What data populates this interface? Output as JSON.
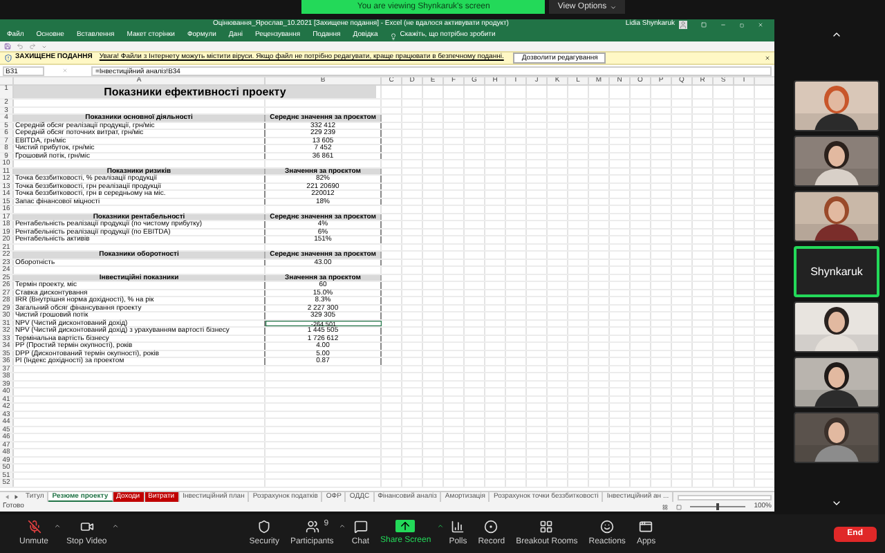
{
  "banner": {
    "text": "You are viewing Shynkaruk's screen",
    "options": "View Options"
  },
  "excel": {
    "title": "Оцінювання_Ярослав_10.2021 [Захищене подання] - Excel (не вдалося активувати продукт)",
    "user": "Lidia Shynkaruk",
    "menu": [
      "Файл",
      "Основне",
      "Вставлення",
      "Макет сторінки",
      "Формули",
      "Дані",
      "Рецензування",
      "Подання",
      "Довідка"
    ],
    "search": "Скажіть, що потрібно зробити",
    "security_bar": {
      "label": "ЗАХИЩЕНЕ ПОДАННЯ",
      "message": "Увага! Файли з Інтернету можуть містити віруси. Якщо файл не потрібно редагувати, краще працювати в безпечному поданні.",
      "button": "Дозволити редагування"
    },
    "formula_bar": {
      "name_box": "B31",
      "formula": "=Інвестиційний аналіз!B34"
    },
    "columns": [
      "A",
      "B",
      "C",
      "D",
      "E",
      "F",
      "G",
      "H",
      "I",
      "J",
      "K",
      "L",
      "M",
      "N",
      "O",
      "P",
      "Q",
      "R",
      "S",
      "T"
    ],
    "rows": [
      {
        "number": "1",
        "kind": "title",
        "label": "Показники ефективності проекту"
      },
      {
        "number": "2",
        "kind": "empty"
      },
      {
        "number": "3",
        "kind": "empty"
      },
      {
        "number": "4",
        "kind": "header",
        "label": "Показники основної діяльності",
        "value": "Середнє значення за проєктом"
      },
      {
        "number": "5",
        "kind": "data",
        "label": "Середній обсяг реалізації продукції, грн/міс",
        "value": "332 412",
        "selected": false
      },
      {
        "number": "6",
        "kind": "data",
        "label": "Середній обсяг поточних витрат, грн/міс",
        "value": "229 239",
        "selected": false
      },
      {
        "number": "7",
        "kind": "data",
        "label": "EBITDA, грн/міс",
        "value": "13 605",
        "selected": false
      },
      {
        "number": "8",
        "kind": "data",
        "label": "Чистий прибуток, грн/міс",
        "value": "7 452",
        "selected": false
      },
      {
        "number": "9",
        "kind": "data",
        "label": "Грошовий потік, грн/міс",
        "value": "36 861",
        "selected": false
      },
      {
        "number": "10",
        "kind": "empty"
      },
      {
        "number": "11",
        "kind": "header",
        "label": "Показники ризиків",
        "value": "Значення за проєктом"
      },
      {
        "number": "12",
        "kind": "data",
        "label": "Точка беззбитковості, % реалізації продукції",
        "value": "82%",
        "selected": false
      },
      {
        "number": "13",
        "kind": "data",
        "label": "Точка беззбитковості, грн реалізації продукції",
        "value": "221 20690",
        "selected": false
      },
      {
        "number": "14",
        "kind": "data",
        "label": "Точка беззбитковості, грн в середньому на міс.",
        "value": "220012",
        "selected": false
      },
      {
        "number": "15",
        "kind": "data",
        "label": "Запас фінансової міцності",
        "value": "18%",
        "selected": false
      },
      {
        "number": "16",
        "kind": "empty"
      },
      {
        "number": "17",
        "kind": "header",
        "label": "Показники рентабельності",
        "value": "Середнє значення за проєктом"
      },
      {
        "number": "18",
        "kind": "data",
        "label": "Рентабельність реалізації продукції (по чистому прибутку)",
        "value": "4%",
        "selected": false
      },
      {
        "number": "19",
        "kind": "data",
        "label": "Рентабельність реалізації продукції (по EBITDA)",
        "value": "6%",
        "selected": false
      },
      {
        "number": "20",
        "kind": "data",
        "label": "Рентабельність активів",
        "value": "151%",
        "selected": false
      },
      {
        "number": "21",
        "kind": "empty"
      },
      {
        "number": "22",
        "kind": "header",
        "label": "Показники оборотності",
        "value": "Середнє значення за проєктом"
      },
      {
        "number": "23",
        "kind": "data",
        "label": "Оборотність",
        "value": "43.00",
        "selected": false
      },
      {
        "number": "24",
        "kind": "empty"
      },
      {
        "number": "25",
        "kind": "header",
        "label": "Інвестиційні показники",
        "value": "Значення за проєктом"
      },
      {
        "number": "26",
        "kind": "data",
        "label": "Термін проекту, міс",
        "value": "60",
        "selected": false
      },
      {
        "number": "27",
        "kind": "data",
        "label": "Ставка дисконтування",
        "value": "15.0%",
        "selected": false
      },
      {
        "number": "28",
        "kind": "data",
        "label": "IRR (Внутрішня норма дохідності), % на рік",
        "value": "8.3%",
        "selected": false
      },
      {
        "number": "29",
        "kind": "data",
        "label": "Загальний обсяг фінансування проекту",
        "value": "2 227 300",
        "selected": false
      },
      {
        "number": "30",
        "kind": "data",
        "label": "Чистий грошовий потік",
        "value": "329 305",
        "selected": false
      },
      {
        "number": "31",
        "kind": "data",
        "label": "NPV (Чистий дисконтований дохід)",
        "value": "-264 501",
        "selected": true
      },
      {
        "number": "32",
        "kind": "data",
        "label": "NPV (Чистий дисконтований дохід) з урахуванням вартості бізнесу",
        "value": "1 445 505",
        "selected": false
      },
      {
        "number": "33",
        "kind": "data",
        "label": "Термінальна вартість бізнесу",
        "value": "1 726 612",
        "selected": false
      },
      {
        "number": "34",
        "kind": "data",
        "label": "PP (Простий термін окупності), років",
        "value": "4.00",
        "selected": false
      },
      {
        "number": "35",
        "kind": "data",
        "label": "DPP (Дисконтований термін окупності), років",
        "value": "5.00",
        "selected": false
      },
      {
        "number": "36",
        "kind": "data",
        "label": "PI (Індекс дохідності) за проектом",
        "value": "0.87",
        "selected": false
      },
      {
        "number": "37",
        "kind": "empty"
      },
      {
        "number": "38",
        "kind": "empty"
      },
      {
        "number": "39",
        "kind": "empty"
      },
      {
        "number": "40",
        "kind": "empty"
      },
      {
        "number": "41",
        "kind": "empty"
      },
      {
        "number": "42",
        "kind": "empty"
      },
      {
        "number": "43",
        "kind": "empty"
      },
      {
        "number": "44",
        "kind": "empty"
      },
      {
        "number": "45",
        "kind": "empty"
      },
      {
        "number": "46",
        "kind": "empty"
      },
      {
        "number": "47",
        "kind": "empty"
      },
      {
        "number": "48",
        "kind": "empty"
      },
      {
        "number": "49",
        "kind": "empty"
      },
      {
        "number": "50",
        "kind": "empty"
      },
      {
        "number": "51",
        "kind": "empty"
      },
      {
        "number": "52",
        "kind": "empty"
      }
    ],
    "sheet_tabs": [
      {
        "label": "Титул",
        "selected": false
      },
      {
        "label": "Резюме проекту",
        "selected": true
      },
      {
        "label": "Доходи",
        "selected": false,
        "color": "#c00000"
      },
      {
        "label": "Витрати",
        "selected": false,
        "color": "#c00000"
      },
      {
        "label": "Інвестиційний план",
        "selected": false
      },
      {
        "label": "Розрахунок податків",
        "selected": false
      },
      {
        "label": "ОФР",
        "selected": false
      },
      {
        "label": "ОДДС",
        "selected": false
      },
      {
        "label": "Фінансовий аналіз",
        "selected": false
      },
      {
        "label": "Амортизація",
        "selected": false
      },
      {
        "label": "Розрахунок точки беззбитковості",
        "selected": false
      },
      {
        "label": "Інвестиційний ан ...",
        "selected": false
      }
    ],
    "status": "Готово",
    "zoom_slider": {
      "level": 0.5
    },
    "zoom": "100%"
  },
  "participants": [
    {
      "kind": "picture",
      "active": false
    },
    {
      "kind": "picture",
      "active": false
    },
    {
      "kind": "picture",
      "active": false
    },
    {
      "kind": "name",
      "name": "Shynkaruk",
      "active": true
    },
    {
      "kind": "picture",
      "active": false
    },
    {
      "kind": "picture",
      "active": false
    },
    {
      "kind": "picture",
      "active": false
    }
  ],
  "toolbar": [
    {
      "kind": "mic",
      "label": "Unmute",
      "caret": true
    },
    {
      "kind": "video",
      "label": "Stop Video",
      "caret": true
    },
    {
      "kind": "security",
      "label": "Security",
      "caret": false
    },
    {
      "kind": "participants",
      "label": "Participants",
      "badge": "9",
      "caret": true
    },
    {
      "kind": "chat",
      "label": "Chat",
      "caret": false
    },
    {
      "kind": "share",
      "label": "Share Screen",
      "caret": true
    },
    {
      "kind": "polls",
      "label": "Polls",
      "caret": false
    },
    {
      "kind": "record",
      "label": "Record",
      "caret": false
    },
    {
      "kind": "breakout",
      "label": "Breakout Rooms",
      "caret": false
    },
    {
      "kind": "reactions",
      "label": "Reactions",
      "caret": false
    },
    {
      "kind": "apps",
      "label": "Apps",
      "caret": false
    }
  ],
  "end": "End"
}
